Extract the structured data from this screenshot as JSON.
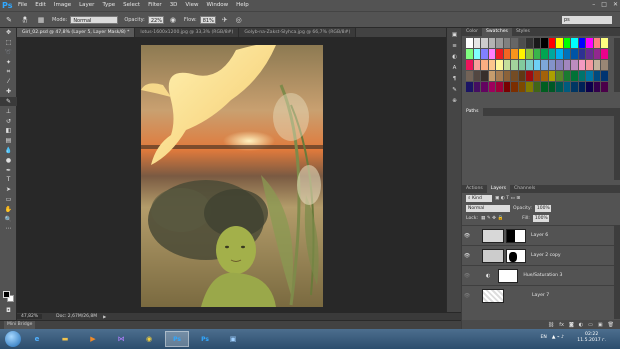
{
  "app": {
    "logo": "Ps"
  },
  "menu": [
    "File",
    "Edit",
    "Image",
    "Layer",
    "Type",
    "Select",
    "Filter",
    "3D",
    "View",
    "Window",
    "Help"
  ],
  "window_controls": [
    "–",
    "□",
    "✕"
  ],
  "options": {
    "brush_size": "97",
    "mode_label": "Mode:",
    "mode_value": "Normal",
    "opacity_label": "Opacity:",
    "opacity_value": "22%",
    "flow_label": "Flow:",
    "flow_value": "81%",
    "search_value": "ps"
  },
  "tabs": [
    "Girl_02.psd @ 47,8% (Layer 5, Layer Mask/8) *",
    "lotus-1600x1200.jpg @ 33,3% (RGB/8#)",
    "Golyb-na-Zakst-Slyhca.jpg @ 66,7% (RGB/8#)"
  ],
  "status": {
    "zoom": "47,82%",
    "doc": "Doc: 2,67M/26,8M"
  },
  "mini_bridge": "Mini Bridge",
  "swatches_panel": {
    "tabs": [
      "Color",
      "Swatches",
      "Styles"
    ],
    "colors": [
      "#ffffff",
      "#e6e6e6",
      "#cccccc",
      "#b3b3b3",
      "#999999",
      "#808080",
      "#666666",
      "#4d4d4d",
      "#333333",
      "#1a1a1a",
      "#000000",
      "#ff0000",
      "#ffff00",
      "#00ff00",
      "#00ffff",
      "#0000ff",
      "#ff00ff",
      "#ff8080",
      "#ffff80",
      "#80ff80",
      "#80ffff",
      "#8080ff",
      "#ff80ff",
      "#ed1c24",
      "#f26522",
      "#f7941d",
      "#fff200",
      "#8dc63f",
      "#39b54a",
      "#00a651",
      "#00a99d",
      "#00aeef",
      "#0072bc",
      "#0054a6",
      "#2e3192",
      "#662d91",
      "#92278f",
      "#ec008c",
      "#ed145b",
      "#f9a19a",
      "#fbad82",
      "#fdc68c",
      "#fff799",
      "#c4df9b",
      "#a3d39c",
      "#82ca9d",
      "#7bcdc8",
      "#6dcff6",
      "#7da7d8",
      "#8393ca",
      "#8781bd",
      "#a186be",
      "#bd8cbf",
      "#f49ac1",
      "#f5989d",
      "#c6b29c",
      "#998675",
      "#736357",
      "#534741",
      "#372f2b",
      "#c69c6d",
      "#a67c52",
      "#8c6239",
      "#754c24",
      "#603813",
      "#9e0b0f",
      "#a0410d",
      "#a36209",
      "#aba000",
      "#598527",
      "#1a7b30",
      "#007236",
      "#00746b",
      "#0076a3",
      "#004b80",
      "#003471",
      "#1b1464",
      "#440e62",
      "#630460",
      "#9e005d",
      "#9e0039",
      "#790000",
      "#7b2e00",
      "#7d4900",
      "#827b00",
      "#406618",
      "#005e20",
      "#005826",
      "#005952",
      "#005b7f",
      "#003663",
      "#002157",
      "#0d004c",
      "#32004b",
      "#4b0049"
    ]
  },
  "paths_panel": {
    "tabs": [
      "Paths"
    ]
  },
  "layers_panel": {
    "tabs": [
      "Actions",
      "Layers",
      "Channels"
    ],
    "kind": "Kind",
    "blend": "Normal",
    "opacity_label": "Opacity:",
    "opacity": "100%",
    "lock_label": "Lock:",
    "fill_label": "Fill:",
    "fill": "100%",
    "layers": [
      {
        "name": "Layer 6"
      },
      {
        "name": "Layer 2 copy"
      },
      {
        "name": "Hue/Saturation 3"
      },
      {
        "name": "Layer 7"
      }
    ]
  },
  "taskbar": {
    "lang": "EN",
    "time": "02:22",
    "date": "11.5.2017 г."
  }
}
